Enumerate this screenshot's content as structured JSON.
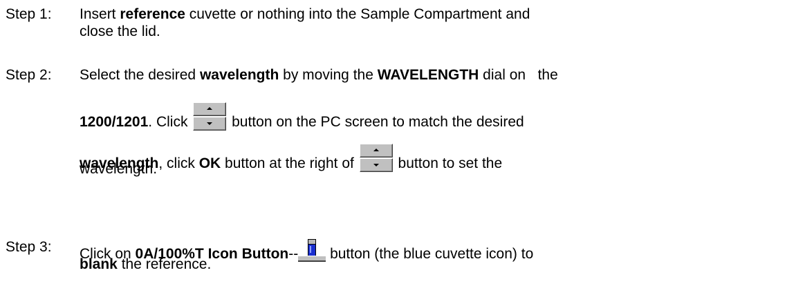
{
  "step1": {
    "label": "Step 1:",
    "l1_a": "Insert ",
    "l1_b": "reference",
    "l1_c": " cuvette or nothing into the Sample Compartment and",
    "l2": "close the lid."
  },
  "step2": {
    "label": "Step 2:",
    "l1_a": "Select the desired ",
    "l1_b": "wavelength",
    "l1_c": " by moving the ",
    "l1_d": "WAVELENGTH",
    "l1_e": " dial on   the",
    "l2_a": "1200/1201",
    "l2_b": ". Click ",
    "l2_c": " button on the PC screen to match the desired",
    "l3_a": "wavelength",
    "l3_b": ", click ",
    "l3_c": "OK",
    "l3_d": " button at the right of ",
    "l3_e": " button to set the",
    "l4": "wavelength."
  },
  "step3": {
    "label": "Step 3:",
    "l1_a": "Click on ",
    "l1_b": "0A/100%T Icon Button",
    "l1_c": "--",
    "l1_d": " button (the blue cuvette icon) to",
    "l2_a": "blank",
    "l2_b": " the reference."
  },
  "icons": {
    "spin_button": "up-down-spin-button-icon",
    "blank_button": "blue-cuvette-icon",
    "cuvette_color": "#1a2fd0"
  }
}
